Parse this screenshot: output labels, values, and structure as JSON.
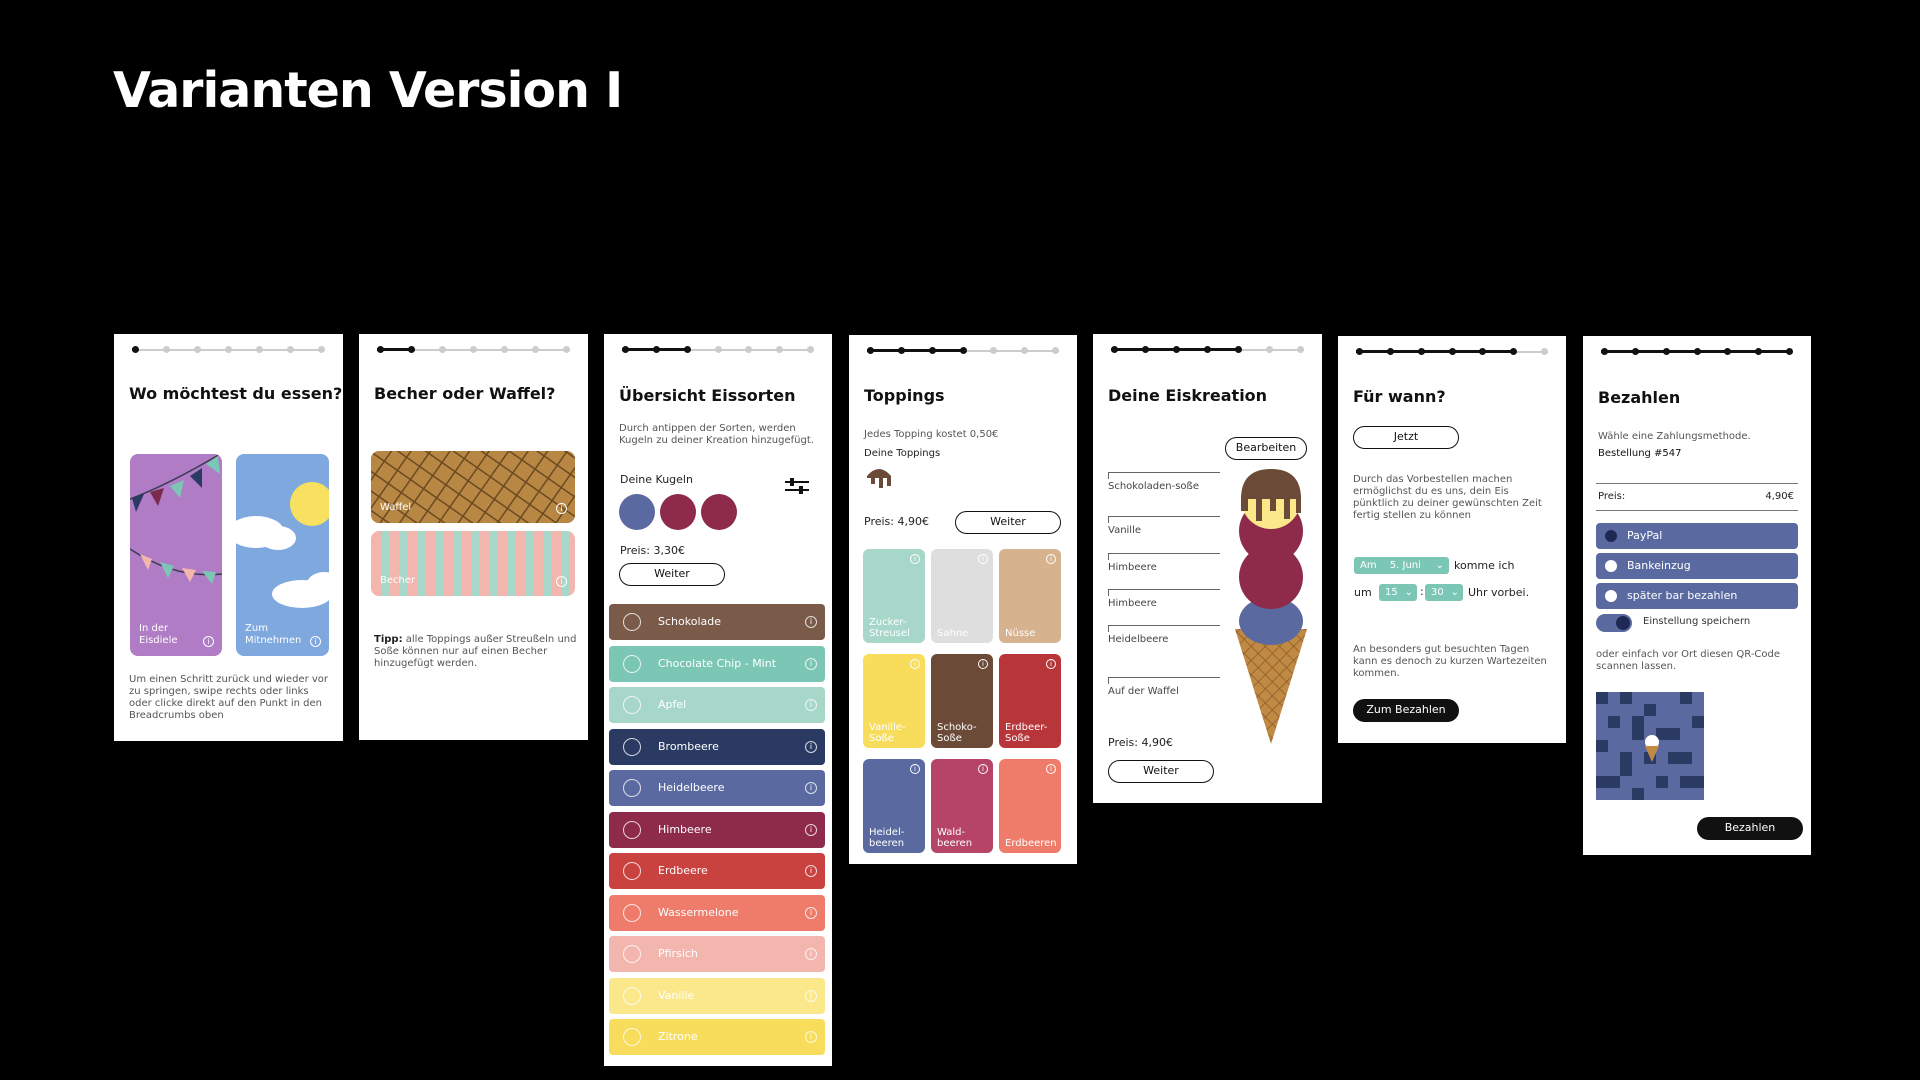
{
  "page": {
    "title": "Varianten Version I"
  },
  "screen1": {
    "title": "Wo möchtest du essen?",
    "option_a": "In der Eisdiele",
    "option_b": "Zum Mitnehmen",
    "hint": "Um einen Schritt zurück und wieder vor zu springen, swipe rechts oder links oder clicke direkt auf den Punkt in den Breadcrumbs oben"
  },
  "screen2": {
    "title": "Becher oder Waffel?",
    "option_a": "Waffel",
    "option_b": "Becher",
    "tip_label": "Tipp:",
    "tip_text": " alle Toppings außer Streußeln und Soße können nur auf einen Becher hinzugefügt werden."
  },
  "screen3": {
    "title": "Übersicht Eissorten",
    "intro": "Durch antippen der Sorten, werden Kugeln zu deiner Kreation hinzugefügt.",
    "scoops_label": "Deine Kugeln",
    "price": "Preis: 3,30€",
    "next": "Weiter",
    "flavors": [
      {
        "name": "Schokolade",
        "color": "#7a5a48"
      },
      {
        "name": "Chocolate Chip - Mint",
        "color": "#7cc6b5"
      },
      {
        "name": "Apfel",
        "color": "#a6d7c8"
      },
      {
        "name": "Brombeere",
        "color": "#2b3a63"
      },
      {
        "name": "Heidelbeere",
        "color": "#5a6aa0"
      },
      {
        "name": "Himbeere",
        "color": "#8e2a4a"
      },
      {
        "name": "Erdbeere",
        "color": "#c9423f"
      },
      {
        "name": "Wassermelone",
        "color": "#ef7c6b"
      },
      {
        "name": "Pfirsich",
        "color": "#f3b6ae"
      },
      {
        "name": "Vanille",
        "color": "#fbe88a"
      },
      {
        "name": "Zitrone",
        "color": "#f8dd5c"
      }
    ]
  },
  "screen4": {
    "title": "Toppings",
    "intro": "Jedes Topping kostet 0,50€",
    "mine_label": "Deine Toppings",
    "price": "Preis: 4,90€",
    "next": "Weiter",
    "tiles": [
      {
        "name": "Zucker-Streusel",
        "color": "#a6d7c8"
      },
      {
        "name": "Sahne",
        "color": "#dedede"
      },
      {
        "name": "Nüsse",
        "color": "#d6b28e"
      },
      {
        "name": "Vanille-Soße",
        "color": "#f8dd5c"
      },
      {
        "name": "Schoko-Soße",
        "color": "#6b4a38"
      },
      {
        "name": "Erdbeer-Soße",
        "color": "#b8353a"
      },
      {
        "name": "Heidel-beeren",
        "color": "#5a6aa0"
      },
      {
        "name": "Wald-beeren",
        "color": "#b64466"
      },
      {
        "name": "Erdbeeren",
        "color": "#ef7c6b"
      }
    ]
  },
  "screen5": {
    "title": "Deine Eiskreation",
    "edit": "Bearbeiten",
    "items": [
      "Schokoladen-soße",
      "Vanille",
      "Himbeere",
      "Himbeere",
      "Heidelbeere",
      "Auf der Waffel"
    ],
    "price": "Preis: 4,90€",
    "next": "Weiter"
  },
  "screen6": {
    "title": "Für wann?",
    "now": "Jetzt",
    "intro": "Durch das Vorbestellen machen ermöglichst du es uns, dein Eis pünktlich zu deiner gewünschten Zeit fertig stellen zu können",
    "am": "Am",
    "date": "5. Juni",
    "come": "komme ich",
    "um": "um",
    "hour": "15",
    "colon": ":",
    "minute": "30",
    "pass": "Uhr vorbei.",
    "note": "An besonders gut besuchten Tagen kann es denoch zu kurzen Wartezeiten kommen.",
    "cta": "Zum Bezahlen"
  },
  "screen7": {
    "title": "Bezahlen",
    "intro": "Wähle eine  Zahlungsmethode.",
    "order": "Bestellung #547",
    "price_label": "Preis:",
    "price_value": "4,90€",
    "methods": [
      "PayPal",
      "Bankeinzug",
      "später bar bezahlen"
    ],
    "save": "Einstellung speichern",
    "qr_text": "oder einfach vor Ort diesen QR-Code scannen lassen.",
    "cta": "Bezahlen"
  },
  "colors": {
    "accent_blue": "#5a6aa0",
    "mint": "#7cc6b5",
    "purple": "#b07cc6",
    "sky": "#7ea8de"
  }
}
